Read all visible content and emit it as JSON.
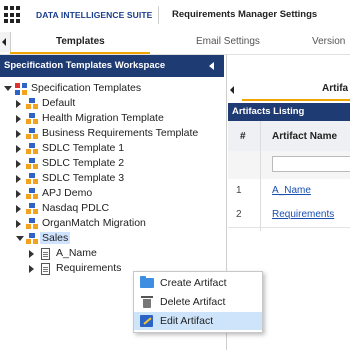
{
  "header": {
    "brand": "DATA INTELLIGENCE SUITE",
    "page_title": "Requirements Manager Settings"
  },
  "tabs": [
    {
      "label": "Templates",
      "active": true
    },
    {
      "label": "Email Settings",
      "active": false
    },
    {
      "label": "Version",
      "active": false
    }
  ],
  "left_panel": {
    "title": "Specification Templates Workspace",
    "tree": {
      "root": "Specification Templates",
      "templates": [
        "Default",
        "Health Migration Template",
        "Business Requirements Template",
        "SDLC Template 1",
        "SDLC Template 2",
        "SDLC Template 3",
        "APJ Demo",
        "Nasdaq PDLC",
        "OrganMatch Migration",
        "Sales"
      ],
      "selected": "Sales",
      "children": [
        "A_Name",
        "Requirements"
      ]
    }
  },
  "right_panel": {
    "tab_label": "Artifa",
    "listing_title": "Artifacts Listing",
    "columns": [
      "#",
      "Artifact Name"
    ],
    "rows": [
      {
        "num": "1",
        "name": "A_Name"
      },
      {
        "num": "2",
        "name": "Requirements"
      }
    ]
  },
  "context_menu": {
    "items": [
      {
        "label": "Create Artifact",
        "icon": "folder-icon"
      },
      {
        "label": "Delete Artifact",
        "icon": "trash-icon"
      },
      {
        "label": "Edit Artifact",
        "icon": "edit-icon",
        "highlighted": true
      }
    ]
  },
  "colors": {
    "navy": "#1f3b73",
    "accent": "#f0a500",
    "link": "#1a4fb0",
    "selection": "#cfe3ff"
  }
}
